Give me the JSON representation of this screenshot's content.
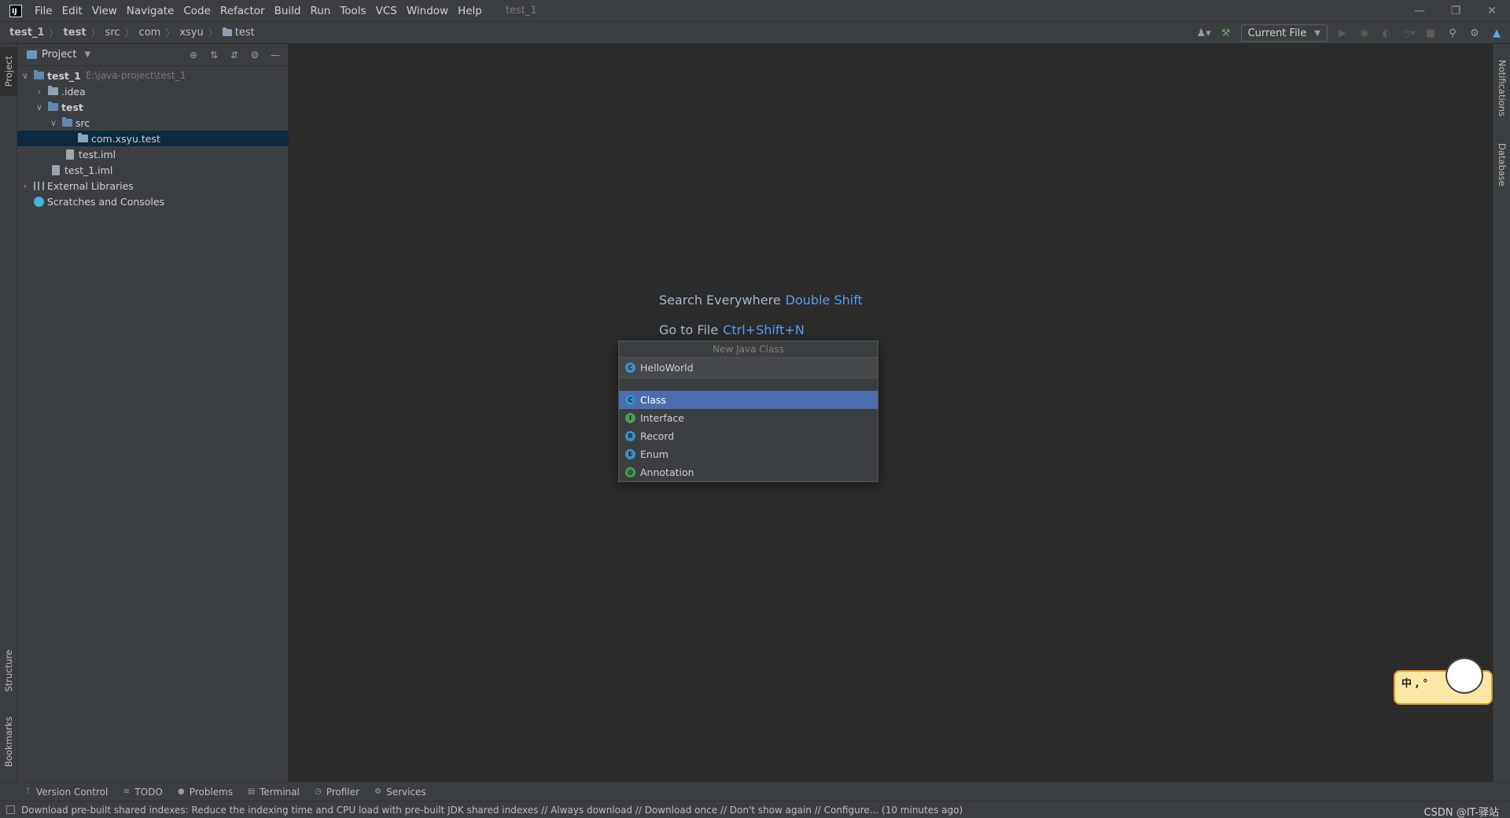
{
  "menubar": {
    "items": [
      "File",
      "Edit",
      "View",
      "Navigate",
      "Code",
      "Refactor",
      "Build",
      "Run",
      "Tools",
      "VCS",
      "Window",
      "Help"
    ],
    "title": "test_1"
  },
  "breadcrumb": [
    "test_1",
    "test",
    "src",
    "com",
    "xsyu",
    "test"
  ],
  "toolbar": {
    "run_config": "Current File"
  },
  "left_stripe": {
    "project": "Project",
    "structure": "Structure",
    "bookmarks": "Bookmarks"
  },
  "right_stripe": {
    "notifications": "Notifications",
    "database": "Database"
  },
  "project_panel": {
    "title": "Project",
    "tree": [
      {
        "label": "test_1",
        "hint": "E:\\java-project\\test_1"
      },
      {
        "label": ".idea"
      },
      {
        "label": "test"
      },
      {
        "label": "src"
      },
      {
        "label": "com.xsyu.test"
      },
      {
        "label": "test.iml"
      },
      {
        "label": "test_1.iml"
      },
      {
        "label": "External Libraries"
      },
      {
        "label": "Scratches and Consoles"
      }
    ]
  },
  "editor_hints": [
    {
      "text": "Search Everywhere",
      "key": "Double Shift"
    },
    {
      "text": "Go to File",
      "key": "Ctrl+Shift+N"
    }
  ],
  "new_class_popup": {
    "title": "New Java Class",
    "input_value": "HelloWorld",
    "kinds": [
      {
        "label": "Class",
        "badge": "C",
        "color": "#3592c4"
      },
      {
        "label": "Interface",
        "badge": "I",
        "color": "#499c54"
      },
      {
        "label": "Record",
        "badge": "R",
        "color": "#3592c4"
      },
      {
        "label": "Enum",
        "badge": "E",
        "color": "#3592c4"
      },
      {
        "label": "Annotation",
        "badge": "@",
        "color": "#499c54"
      }
    ]
  },
  "ime_sticker": {
    "text": "中 , °"
  },
  "bottom_tabs": [
    "Version Control",
    "TODO",
    "Problems",
    "Terminal",
    "Profiler",
    "Services"
  ],
  "status": {
    "message": "Download pre-built shared indexes: Reduce the indexing time and CPU load with pre-built JDK shared indexes // Always download // Download once // Don't show again // Configure... (10 minutes ago)",
    "watermark": "CSDN @IT-驿站"
  }
}
